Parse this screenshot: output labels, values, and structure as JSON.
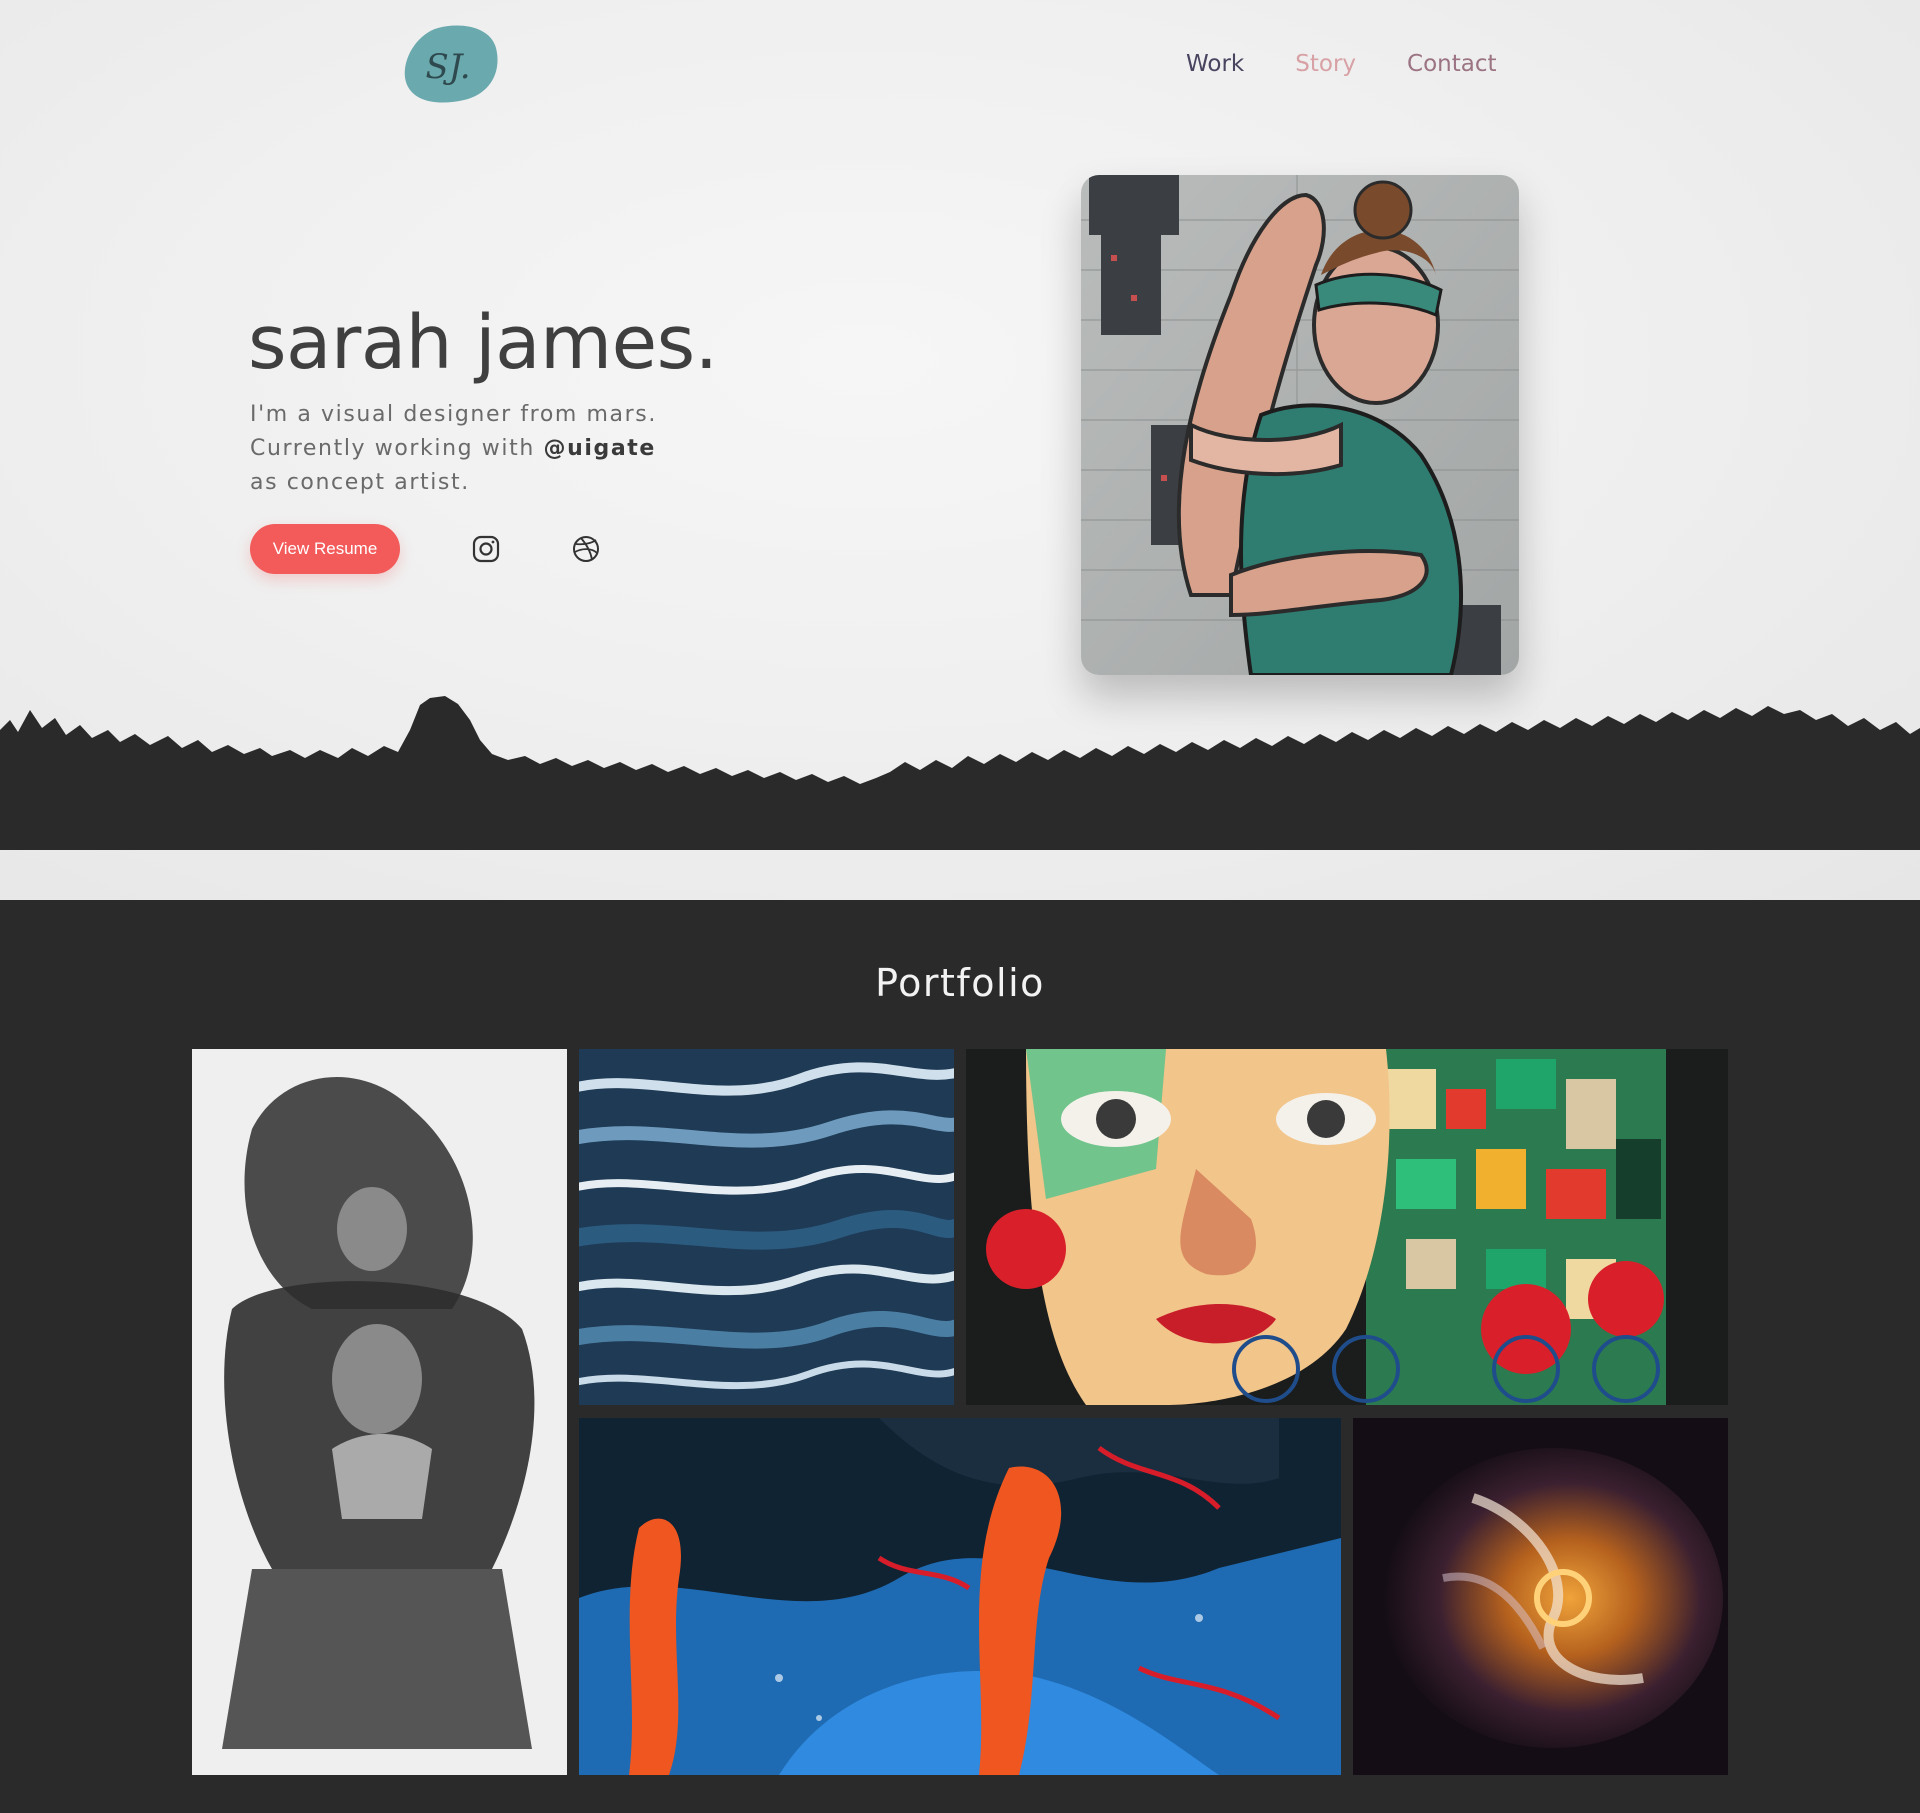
{
  "header": {
    "logo_text": "SJ.",
    "logo_color": "#6aa9ad",
    "nav": [
      {
        "label": "Work",
        "color": "#4a4460"
      },
      {
        "label": "Story",
        "color": "#d7a1a5"
      },
      {
        "label": "Contact",
        "color": "#9b7383"
      }
    ]
  },
  "hero": {
    "name": "sarah james.",
    "bio_line1": "I'm a visual designer from mars.",
    "bio_line2_prefix": "Currently working with ",
    "bio_handle": "@uigate",
    "bio_line3": "as concept artist.",
    "resume_button": "View Resume",
    "accent_color": "#f35a5a",
    "social_icons": [
      "instagram-icon",
      "dribbble-icon"
    ]
  },
  "portfolio": {
    "title": "Portfolio"
  }
}
